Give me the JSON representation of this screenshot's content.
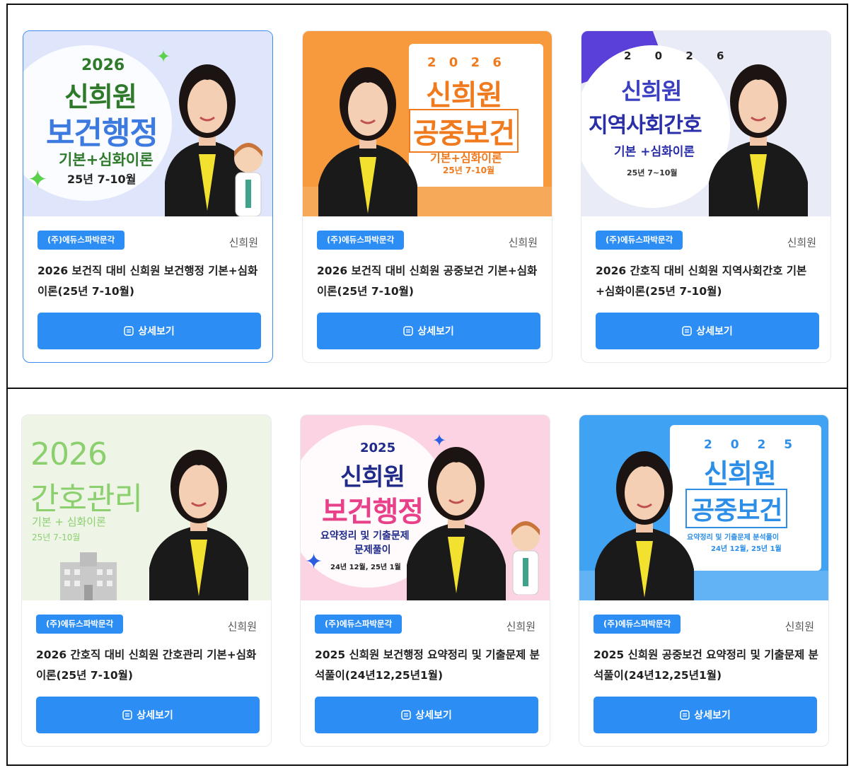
{
  "common": {
    "publisher_badge": "(주)에듀스파박문각",
    "instructor": "신희원",
    "detail_button": "상세보기"
  },
  "cards": [
    {
      "title": "2026 보건직 대비 신희원 보건행정 기본+심화이론(25년 7-10월)",
      "thumb": {
        "year": "2026",
        "name": "신희원",
        "subject": "보건행정",
        "sub1": "기본+심화이론",
        "sub2": "25년 7-10월",
        "bg": "#dfe6fb",
        "accent": "#3d7ae0"
      }
    },
    {
      "title": "2026 보건직 대비 신희원 공중보건 기본+심화이론(25년 7-10월)",
      "thumb": {
        "year": "2 0 2 6",
        "name": "신희원",
        "subject": "공중보건",
        "sub1": "기본+심화이론",
        "sub2": "25년 7-10월",
        "bg": "#f79a3e",
        "accent": "#f07a1e"
      }
    },
    {
      "title": "2026 간호직 대비 신희원 지역사회간호 기본+심화이론(25년 7-10월)",
      "thumb": {
        "year": "2 0 2 6",
        "name": "신희원",
        "subject": "지역사회간호",
        "sub1": "기본 +심화이론",
        "sub2": "25년 7~10월",
        "bg": "#e9ecf6",
        "accent": "#3a3fc2"
      }
    },
    {
      "title": "2026 간호직 대비 신희원 간호관리 기본+심화이론(25년 7-10월)",
      "thumb": {
        "year": "2026",
        "name": "",
        "subject": "간호관리",
        "sub1": "기본 + 심화이론",
        "sub2": "25년 7-10월",
        "bg": "#eef5e6",
        "accent": "#8bcf6f"
      }
    },
    {
      "title": "2025 신희원 보건행정 요약정리 및 기출문제 분석풀이(24년12,25년1월)",
      "thumb": {
        "year": "2025",
        "name": "신희원",
        "subject": "보건행정",
        "sub1": "요약정리 및 기출문제",
        "sub2": "문제풀이",
        "sub3": "24년 12월, 25년 1월",
        "bg": "#fbd3e3",
        "accent": "#e8418a"
      }
    },
    {
      "title": "2025 신희원 공중보건 요약정리 및 기출문제 분석풀이(24년12,25년1월)",
      "thumb": {
        "year": "2 0 2 5",
        "name": "신희원",
        "subject": "공중보건",
        "sub1": "요약정리 및 기출문제 분석풀이",
        "sub2": "24년 12월, 25년 1월",
        "bg": "#3fa2f2",
        "accent": "#2d8ee8"
      }
    }
  ]
}
